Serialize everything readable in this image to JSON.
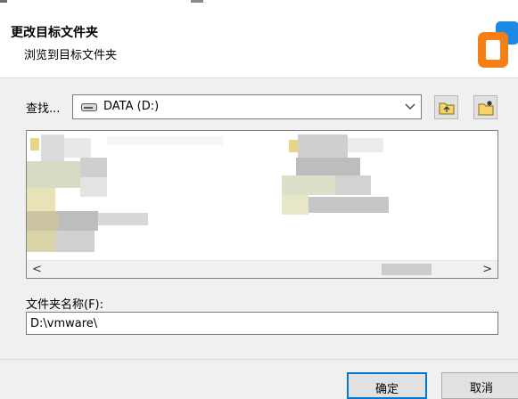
{
  "header": {
    "title": "更改目标文件夹",
    "subtitle": "浏览到目标文件夹"
  },
  "lookin": {
    "label": "查找...",
    "selected": "DATA (D:)"
  },
  "toolbar": {
    "up_icon": "folder-up-icon",
    "new_icon": "new-folder-icon"
  },
  "browser": {
    "scroll_left": "<",
    "scroll_right": ">"
  },
  "folder": {
    "label": "文件夹名称(F):",
    "value": "D:\\vmware\\"
  },
  "buttons": {
    "ok": "确定",
    "cancel": "取消"
  },
  "colors": {
    "accent": "#0078d7",
    "logo_orange": "#f57f17",
    "logo_blue": "#1e88e5"
  }
}
